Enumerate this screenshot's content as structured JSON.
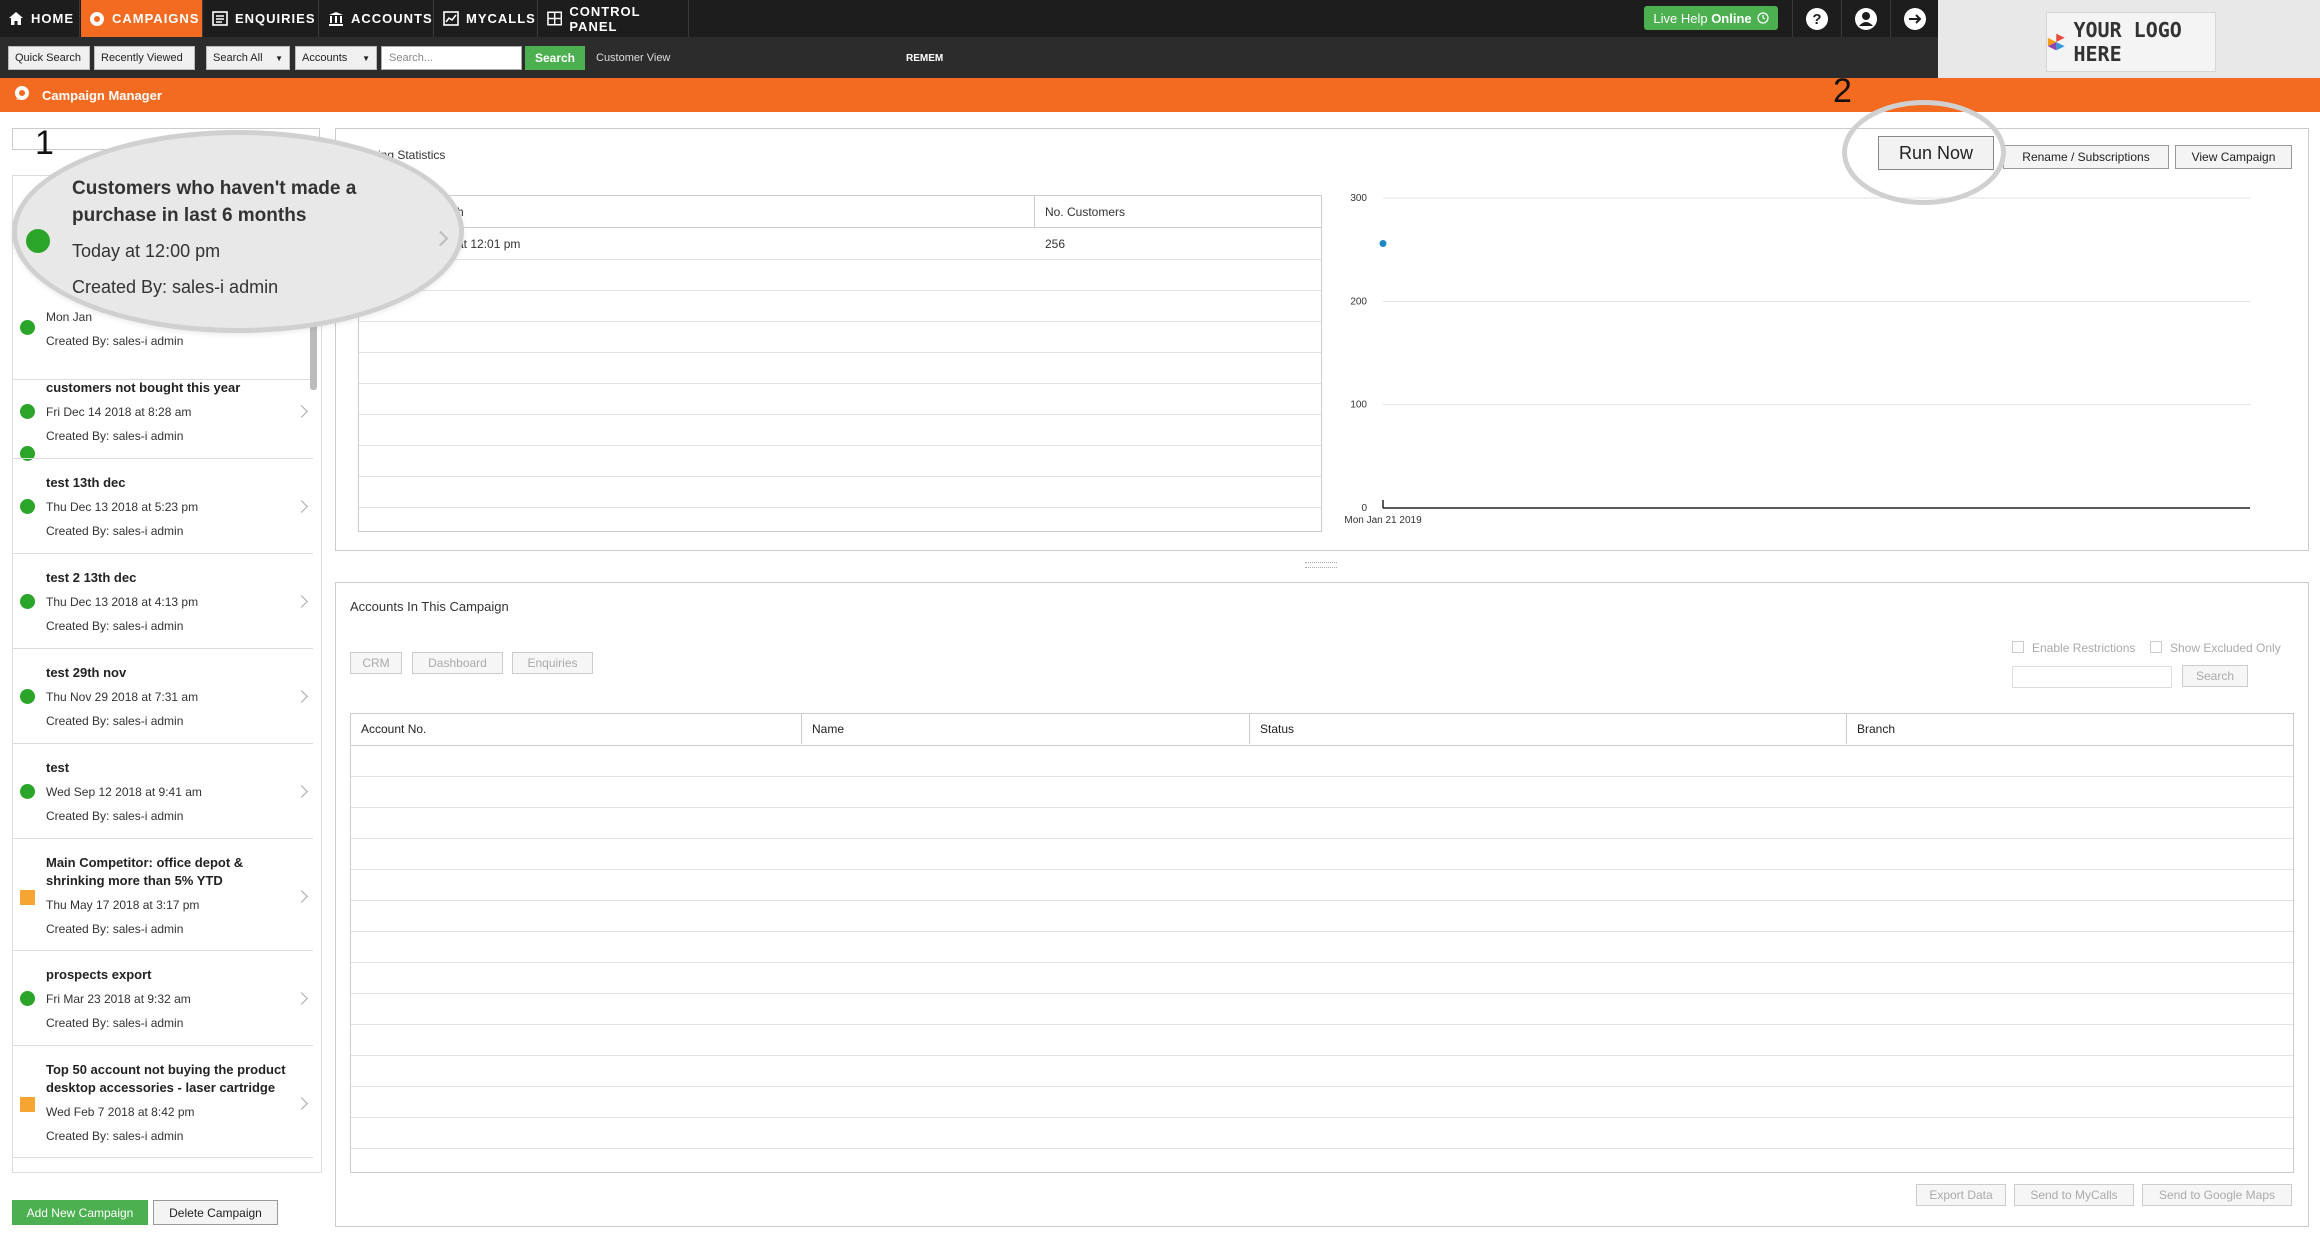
{
  "nav": {
    "items": [
      {
        "label": "HOME",
        "icon": "home-icon"
      },
      {
        "label": "CAMPAIGNS",
        "icon": "campaign-icon",
        "active": true
      },
      {
        "label": "ENQUIRIES",
        "icon": "enquiries-icon"
      },
      {
        "label": "ACCOUNTS",
        "icon": "bank-icon"
      },
      {
        "label": "MYCALLS",
        "icon": "calls-icon"
      },
      {
        "label": "CONTROL PANEL",
        "icon": "grid-icon"
      }
    ],
    "live_help": "Live Help",
    "live_status": "Online",
    "logo_text": "YOUR LOGO HERE"
  },
  "searchbar": {
    "quick_search": "Quick Search",
    "recently_viewed": "Recently Viewed",
    "search_all": "Search All",
    "accounts": "Accounts",
    "placeholder": "Search...",
    "search_button": "Search",
    "customer_view": "Customer View",
    "remem": "REMEM"
  },
  "header": {
    "title": "Campaign Manager"
  },
  "campaigns": {
    "items": [
      {
        "title": "Customers who haven't made a purchase in last 6 months",
        "date": "Today at 12:00 pm",
        "by": "Created By: sales-i admin",
        "status": "green"
      },
      {
        "title": "",
        "date": "Mon Jan",
        "by": "Created By: sales-i admin",
        "status": "green"
      },
      {
        "title": "customers not bought this year",
        "date": "Fri Dec 14 2018 at 8:28 am",
        "by": "Created By: sales-i admin",
        "status": "green"
      },
      {
        "title": "test 13th dec",
        "date": "Thu Dec 13 2018 at 5:23 pm",
        "by": "Created By: sales-i admin",
        "status": "green"
      },
      {
        "title": "test 2 13th dec",
        "date": "Thu Dec 13 2018 at 4:13 pm",
        "by": "Created By: sales-i admin",
        "status": "green"
      },
      {
        "title": "test 29th nov",
        "date": "Thu Nov 29 2018 at 7:31 am",
        "by": "Created By: sales-i admin",
        "status": "green"
      },
      {
        "title": "test",
        "date": "Wed Sep 12 2018 at 9:41 am",
        "by": "Created By: sales-i admin",
        "status": "green"
      },
      {
        "title": "Main Competitor: office depot & shrinking more than 5% YTD",
        "date": "Thu May 17 2018 at 3:17 pm",
        "by": "Created By: sales-i admin",
        "status": "orange"
      },
      {
        "title": "prospects export",
        "date": "Fri Mar 23 2018 at 9:32 am",
        "by": "Created By: sales-i admin",
        "status": "green"
      },
      {
        "title": "Top 50 account not buying the product desktop accessories - laser cartridge",
        "date": "Wed Feb 7 2018 at 8:42 pm",
        "by": "Created By: sales-i admin",
        "status": "orange"
      }
    ],
    "add_button": "Add New Campaign",
    "delete_button": "Delete Campaign"
  },
  "stats": {
    "title_fragment": "ing Statistics",
    "run_now": "Run Now",
    "rename": "Rename / Subscriptions",
    "view_campaign": "View Campaign",
    "col_run": "h",
    "col_customers": "No. Customers",
    "row_date": "at 12:01 pm",
    "row_count": "256"
  },
  "chart_data": {
    "type": "scatter",
    "x": [
      "Mon Jan 21 2019"
    ],
    "series": [
      {
        "values": [
          256
        ]
      }
    ],
    "y_ticks": [
      "0",
      "100",
      "200",
      "300"
    ],
    "ylim": [
      0,
      300
    ],
    "grid": true,
    "point_color": "#1e88c7"
  },
  "accounts": {
    "title": "Accounts In This Campaign",
    "crm": "CRM",
    "dashboard": "Dashboard",
    "enquiries": "Enquiries",
    "enable_restrictions": "Enable Restrictions",
    "show_excluded": "Show Excluded Only",
    "search": "Search",
    "columns": [
      "Account No.",
      "Name",
      "Status",
      "Branch"
    ],
    "export_data": "Export Data",
    "send_mycalls": "Send to MyCalls",
    "send_maps": "Send to Google Maps"
  },
  "callouts": {
    "one": "1",
    "two": "2"
  },
  "colors": {
    "accent": "#f36b21",
    "success": "#4caf50",
    "dark": "#1d1d1d"
  }
}
